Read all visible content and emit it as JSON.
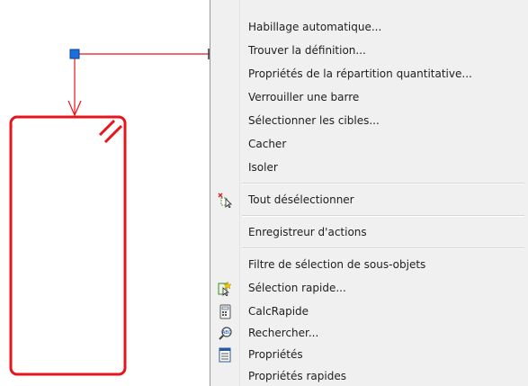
{
  "colors": {
    "drawing_line": "#e8141b",
    "grip": "#1a6fe0",
    "menu_bg": "#f0f0f0",
    "menu_text": "#1e1e1e"
  },
  "context_menu": {
    "items": [
      {
        "label": "Habillage automatique...",
        "icon": null
      },
      {
        "label": "Trouver la définition...",
        "icon": null
      },
      {
        "label": "Propriétés de la répartition quantitative...",
        "icon": null
      },
      {
        "label": "Verrouiller une barre",
        "icon": null
      },
      {
        "label": "Sélectionner les cibles...",
        "icon": null
      },
      {
        "label": "Cacher",
        "icon": null
      },
      {
        "label": "Isoler",
        "icon": null
      },
      {
        "label": "Tout désélectionner",
        "icon": "deselect-all-icon"
      },
      {
        "label": "Enregistreur d'actions",
        "icon": null
      },
      {
        "label": "Filtre de sélection de sous-objets",
        "icon": null
      },
      {
        "label": "Sélection rapide...",
        "icon": "quick-select-icon"
      },
      {
        "label": "CalcRapide",
        "icon": "calculator-icon"
      },
      {
        "label": "Rechercher...",
        "icon": "find-text-icon"
      },
      {
        "label": "Propriétés",
        "icon": "properties-icon"
      },
      {
        "label": "Propriétés rapides",
        "icon": null
      }
    ]
  }
}
